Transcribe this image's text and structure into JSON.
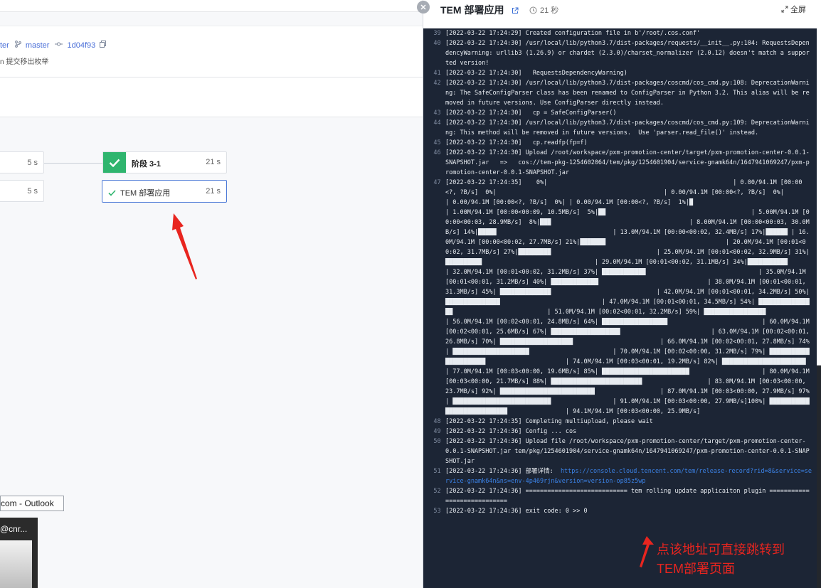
{
  "left": {
    "branch_fragment": "ter",
    "branch_name": "master",
    "commit_hash": "1d04f93",
    "commit_message": "n 提交移出枚举",
    "stages": [
      {
        "duration": "5 s"
      },
      {
        "duration": "5 s"
      }
    ],
    "stage_group": {
      "title": "阶段 3-1",
      "duration": "21 s"
    },
    "job": {
      "label": "TEM 部署应用",
      "duration": "21 s"
    },
    "outlook_tooltip": "com - Outlook",
    "thumbnail_title": "@cnr..."
  },
  "drawer": {
    "title": "TEM 部署应用",
    "elapsed": "21 秒",
    "fullscreen_label": "全屏"
  },
  "log_lines": [
    {
      "n": "39",
      "t": "[2022-03-22 17:24:29] Created configuration file in b'/root/.cos.conf'"
    },
    {
      "n": "40",
      "t": "[2022-03-22 17:24:30] /usr/local/lib/python3.7/dist-packages/requests/__init__.py:104: RequestsDependencyWarning: urllib3 (1.26.9) or chardet (2.3.0)/charset_normalizer (2.0.12) doesn't match a supported version!"
    },
    {
      "n": "41",
      "t": "[2022-03-22 17:24:30]   RequestsDependencyWarning)"
    },
    {
      "n": "42",
      "t": "[2022-03-22 17:24:30] /usr/local/lib/python3.7/dist-packages/coscmd/cos_cmd.py:108: DeprecationWarning: The SafeConfigParser class has been renamed to ConfigParser in Python 3.2. This alias will be removed in future versions. Use ConfigParser directly instead."
    },
    {
      "n": "43",
      "t": "[2022-03-22 17:24:30]   cp = SafeConfigParser()"
    },
    {
      "n": "44",
      "t": "[2022-03-22 17:24:30] /usr/local/lib/python3.7/dist-packages/coscmd/cos_cmd.py:109: DeprecationWarning: This method will be removed in future versions.  Use 'parser.read_file()' instead."
    },
    {
      "n": "45",
      "t": "[2022-03-22 17:24:30]   cp.readfp(fp=f)"
    },
    {
      "n": "46",
      "t": "[2022-03-22 17:24:30] Upload /root/workspace/pxm-promotion-center/target/pxm-promotion-center-0.0.1-SNAPSHOT.jar   =>   cos://tem-pkg-1254602064/tem/pkg/1254601904/service-gnamk64n/1647941069247/pxm-promotion-center-0.0.1-SNAPSHOT.jar"
    },
    {
      "n": "47",
      "t": "[2022-03-22 17:24:35]    0%|                                                   | 0.00/94.1M [00:00<?, ?B/s]  0%|                                              | 0.00/94.1M [00:00<?, ?B/s]  0%|                                               | 0.00/94.1M [00:00<?, ?B/s]  0%| | 0.00/94.1M [00:00<?, ?B/s]  1%|█                                           | 1.00M/94.1M [00:00<00:09, 10.5MB/s]  5%|██                                        | 5.00M/94.1M [00:00<00:03, 28.9MB/s]  8%|███                                      | 8.00M/94.1M [00:00<00:03, 30.0MB/s] 14%|█████                                | 13.0M/94.1M [00:00<00:02, 32.4MB/s] 17%|██████ | 16.0M/94.1M [00:00<00:02, 27.7MB/s] 21%|███████                                 | 20.0M/94.1M [00:01<00:02, 31.7MB/s] 27%|█████████                             | 25.0M/94.1M [00:01<00:02, 32.9MB/s] 31%|██████████                               | 29.0M/94.1M [00:01<00:02, 31.1MB/s] 34%|███████████                             | 32.0M/94.1M [00:01<00:02, 31.2MB/s] 37%| ████████████                               | 35.0M/94.1M [00:01<00:01, 31.2MB/s] 40%| █████████████                              | 38.0M/94.1M [00:01<00:01, 31.3MB/s] 45%| ██████████████                             | 42.0M/94.1M [00:01<00:01, 34.2MB/s] 50%| ███████████████                            | 47.0M/94.1M [00:01<00:01, 34.5MB/s] 54%| ████████████████                          | 51.0M/94.1M [00:02<00:01, 32.2MB/s] 59%| █████████████████                         | 56.0M/94.1M [00:02<00:01, 24.8MB/s] 64%| ██████████████████                          | 60.0M/94.1M [00:02<00:01, 25.6MB/s] 67%| ███████████████████                         | 63.0M/94.1M [00:02<00:01, 26.8MB/s] 70%| ████████████████████                        | 66.0M/94.1M [00:02<00:01, 27.8MB/s] 74%| █████████████████████                       | 70.0M/94.1M [00:02<00:00, 31.2MB/s] 79%| ██████████████████████                      | 74.0M/94.1M [00:03<00:01, 19.2MB/s] 82%| ███████████████████████                    | 77.0M/94.1M [00:03<00:00, 19.6MB/s] 85%| ████████████████████████                    | 80.0M/94.1M [00:03<00:00, 21.7MB/s] 88%| █████████████████████████                  | 83.0M/94.1M [00:03<00:00, 23.7MB/s] 92%| ██████████████████████████                  | 87.0M/94.1M [00:03<00:00, 27.9MB/s] 97%| ███████████████████████████                 | 91.0M/94.1M [00:03<00:00, 27.9MB/s]100%| ████████████████████████████                | 94.1M/94.1M [00:03<00:00, 25.9MB/s]"
    },
    {
      "n": "48",
      "t": "[2022-03-22 17:24:35] Completing multiupload, please wait"
    },
    {
      "n": "49",
      "t": "[2022-03-22 17:24:36] Config ... cos"
    },
    {
      "n": "50",
      "t": "[2022-03-22 17:24:36] Upload file /root/workspace/pxm-promotion-center/target/pxm-promotion-center-0.0.1-SNAPSHOT.jar tem/pkg/1254601904/service-gnamk64n/1647941069247/pxm-promotion-center-0.0.1-SNAPSHOT.jar"
    },
    {
      "n": "51",
      "t": "[2022-03-22 17:24:36] 部署详情:  ",
      "link": "https://console.cloud.tencent.com/tem/release-record?rid=8&service=service-gnamk64n&ns=env-4p469rjn&version=version-op85z5wp"
    },
    {
      "n": "52",
      "t": "[2022-03-22 17:24:36] ============================ tem rolling update applicaiton plugin ============================"
    },
    {
      "n": "53",
      "t": "[2022-03-22 17:24:36] exit code: 0 >> 0"
    }
  ],
  "annotation": {
    "line1": "点该地址可直接跳转到",
    "line2": "TEM部署页面",
    "color": "#e8251f"
  }
}
